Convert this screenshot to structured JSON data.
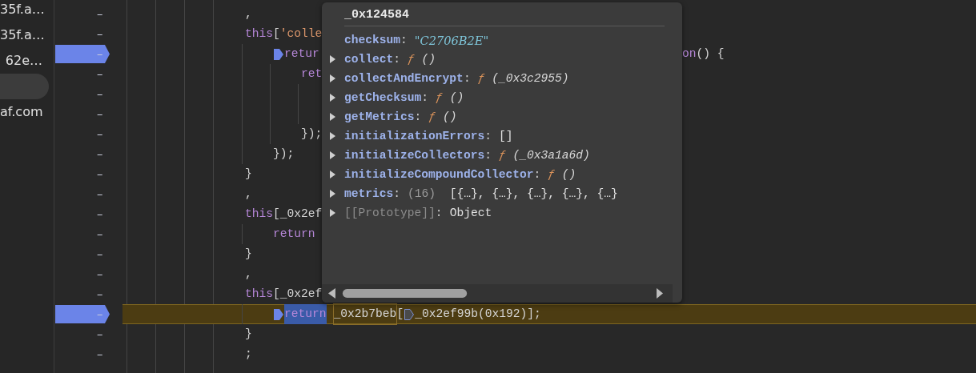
{
  "sidebar": {
    "items": [
      {
        "text": "35f.a…",
        "selected": false
      },
      {
        "text": "35f.a…",
        "selected": false
      },
      {
        "text": "62e…",
        "selected": false
      },
      {
        "selected": true
      },
      {
        "text": "af.com",
        "selected": false
      }
    ]
  },
  "editor": {
    "lines": [
      {
        "number": "–",
        "breakpoint": false,
        "paused": false,
        "tokens": [
          {
            "kind": "plain",
            "text": ","
          }
        ]
      },
      {
        "number": "–",
        "breakpoint": false,
        "paused": false,
        "tokens": [
          {
            "kind": "keyword",
            "text": "this"
          },
          {
            "kind": "plain",
            "text": "["
          },
          {
            "kind": "string",
            "text": "'colle"
          }
        ],
        "children": [
          {
            "number": "–",
            "breakpoint": true,
            "paused": false,
            "tokens": [
              {
                "kind": "marker",
                "active": true
              },
              {
                "kind": "keyword",
                "text": "retur"
              }
            ],
            "after_popover": [
              {
                "kind": "keyword",
                "text": "on"
              },
              {
                "kind": "plain",
                "text": "() {"
              }
            ],
            "children": [
              {
                "number": "–",
                "breakpoint": false,
                "paused": false,
                "tokens": [
                  {
                    "kind": "keyword",
                    "text": "ret"
                  }
                ],
                "children": [
                  {
                    "number": "–",
                    "breakpoint": false,
                    "paused": false
                  },
                  {
                    "number": "–",
                    "breakpoint": false,
                    "paused": false
                  }
                ]
              },
              {
                "number": "–",
                "breakpoint": false,
                "paused": false,
                "tokens": [
                  {
                    "kind": "plain",
                    "text": "});"
                  }
                ]
              }
            ]
          },
          {
            "number": "–",
            "breakpoint": false,
            "paused": false,
            "tokens": [
              {
                "kind": "plain",
                "text": "});"
              }
            ]
          }
        ]
      },
      {
        "number": "–",
        "breakpoint": false,
        "paused": false,
        "tokens": [
          {
            "kind": "plain",
            "text": "}"
          }
        ]
      },
      {
        "number": "–",
        "breakpoint": false,
        "paused": false,
        "tokens": [
          {
            "kind": "plain",
            "text": ","
          }
        ]
      },
      {
        "number": "–",
        "breakpoint": false,
        "paused": false,
        "tokens": [
          {
            "kind": "keyword",
            "text": "this"
          },
          {
            "kind": "plain",
            "text": "[_0x2ef"
          }
        ],
        "children": [
          {
            "number": "–",
            "breakpoint": false,
            "paused": false,
            "tokens": [
              {
                "kind": "keyword",
                "text": "return"
              }
            ]
          }
        ]
      },
      {
        "number": "–",
        "breakpoint": false,
        "paused": false,
        "tokens": [
          {
            "kind": "plain",
            "text": "}"
          }
        ]
      },
      {
        "number": "–",
        "breakpoint": false,
        "paused": false,
        "tokens": [
          {
            "kind": "plain",
            "text": ","
          }
        ]
      },
      {
        "number": "–",
        "breakpoint": false,
        "paused": false,
        "tokens": [
          {
            "kind": "keyword",
            "text": "this"
          },
          {
            "kind": "plain",
            "text": "[_0x2ef"
          }
        ],
        "children": [
          {
            "number": "–",
            "breakpoint": true,
            "paused": true,
            "tokens": [
              {
                "kind": "marker",
                "active": true
              },
              {
                "kind": "keyword",
                "text": "return",
                "selected": true
              },
              {
                "kind": "boxed",
                "text": "_0x2b7beb"
              },
              {
                "kind": "plain",
                "text": "["
              },
              {
                "kind": "marker",
                "active": false
              },
              {
                "kind": "plain",
                "text": "_0x2ef99b(0x192)];"
              }
            ]
          }
        ]
      },
      {
        "number": "–",
        "breakpoint": false,
        "paused": false,
        "tokens": [
          {
            "kind": "plain",
            "text": "}"
          }
        ]
      },
      {
        "number": "–",
        "breakpoint": false,
        "paused": false,
        "tokens": [
          {
            "kind": "plain",
            "text": ";"
          }
        ]
      }
    ]
  },
  "popover": {
    "title": "_0x124584",
    "rows": [
      {
        "key": "checksum",
        "colon": ":",
        "expandable": false,
        "kind": "string",
        "value": "\"C2706B2E\""
      },
      {
        "key": "collect",
        "colon": ":",
        "expandable": true,
        "kind": "function",
        "value": "ƒ",
        "params": "()"
      },
      {
        "key": "collectAndEncrypt",
        "colon": ":",
        "expandable": true,
        "kind": "function",
        "value": "ƒ",
        "params": "(_0x3c2955)"
      },
      {
        "key": "getChecksum",
        "colon": ":",
        "expandable": true,
        "kind": "function",
        "value": "ƒ",
        "params": "()"
      },
      {
        "key": "getMetrics",
        "colon": ":",
        "expandable": true,
        "kind": "function",
        "value": "ƒ",
        "params": "()"
      },
      {
        "key": "initializationErrors",
        "colon": ":",
        "expandable": true,
        "kind": "plain",
        "value": "[]"
      },
      {
        "key": "initializeCollectors",
        "colon": ":",
        "expandable": true,
        "kind": "function",
        "value": "ƒ",
        "params": "(_0x3a1a6d)"
      },
      {
        "key": "initializeCompoundCollector",
        "colon": ":",
        "expandable": true,
        "kind": "function",
        "value": "ƒ",
        "params": "()"
      },
      {
        "key": "metrics",
        "colon": ":",
        "expandable": true,
        "kind": "array",
        "count": "(16)",
        "value": "[{…}, {…}, {…}, {…}, {…}"
      },
      {
        "key": "[[Prototype]]",
        "colon": ":",
        "expandable": true,
        "kind": "internal",
        "value": "Object"
      }
    ]
  }
}
